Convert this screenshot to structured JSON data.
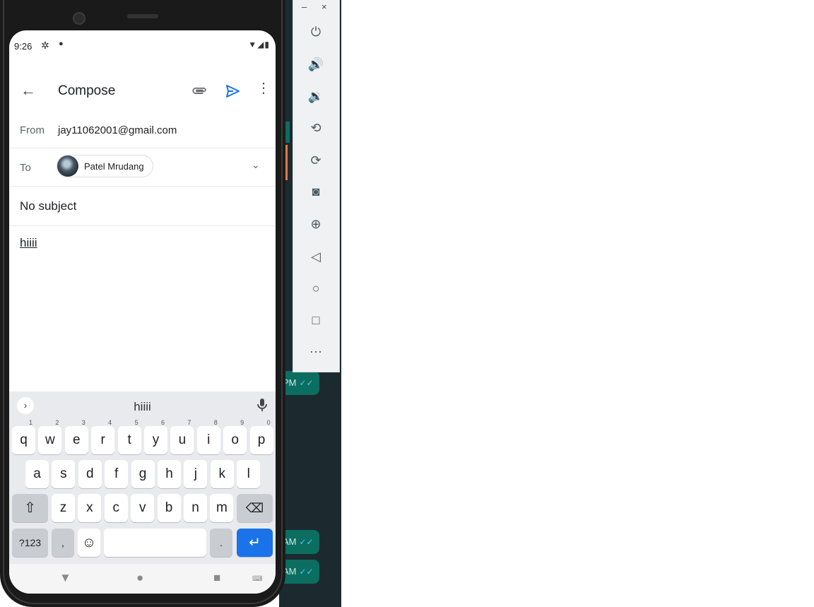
{
  "status_bar": {
    "time": "9:26"
  },
  "app_bar": {
    "title": "Compose"
  },
  "from": {
    "label": "From",
    "value": "jay11062001@gmail.com"
  },
  "to": {
    "label": "To",
    "recipient": "Patel Mrudang"
  },
  "subject": {
    "placeholder": "No subject"
  },
  "body": {
    "text": "hiiii"
  },
  "keyboard": {
    "suggestion": "hiiii",
    "row1": [
      {
        "k": "q",
        "n": "1"
      },
      {
        "k": "w",
        "n": "2"
      },
      {
        "k": "e",
        "n": "3"
      },
      {
        "k": "r",
        "n": "4"
      },
      {
        "k": "t",
        "n": "5"
      },
      {
        "k": "y",
        "n": "6"
      },
      {
        "k": "u",
        "n": "7"
      },
      {
        "k": "i",
        "n": "8"
      },
      {
        "k": "o",
        "n": "9"
      },
      {
        "k": "p",
        "n": "0"
      }
    ],
    "row2": [
      "a",
      "s",
      "d",
      "f",
      "g",
      "h",
      "j",
      "k",
      "l"
    ],
    "row3": [
      "z",
      "x",
      "c",
      "v",
      "b",
      "n",
      "m"
    ],
    "symbols_key": "?123",
    "comma_key": ",",
    "period_key": "."
  },
  "chat_bg": {
    "b1": "PM",
    "b2": "AM",
    "b3": "AM"
  },
  "colors": {
    "accent": "#1a73e8",
    "keyboard_bg": "#e8eaed"
  }
}
